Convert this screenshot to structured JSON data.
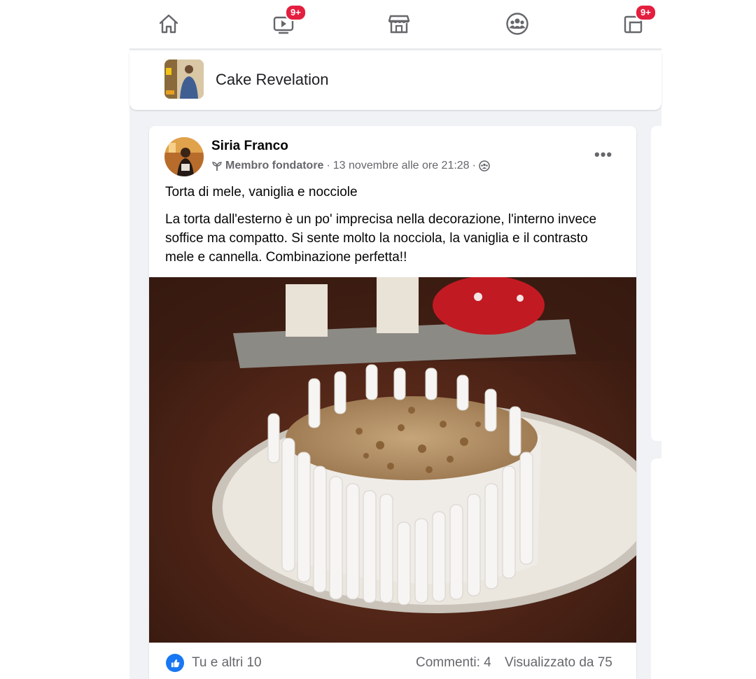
{
  "nav": {
    "items": [
      {
        "name": "home-icon",
        "badge": ""
      },
      {
        "name": "video-icon",
        "badge": "9+"
      },
      {
        "name": "marketplace-icon",
        "badge": ""
      },
      {
        "name": "groups-icon",
        "badge": ""
      },
      {
        "name": "gaming-icon",
        "badge": "9+"
      }
    ],
    "badge_color": "#e41e3f"
  },
  "group": {
    "name": "Cake Revelation"
  },
  "post": {
    "author": "Siria Franco",
    "role": "Membro fondatore",
    "separator": "·",
    "timestamp": "13 novembre alle ore 21:28",
    "privacy_icon": "group-audience-icon",
    "title": "Torta di mele, vaniglia e nocciole",
    "body": "La torta dall'esterno è un po' imprecisa nella decorazione, l'interno invece soffice ma compatto. Si sente molto la nocciola, la vaniglia e il contrasto mele e cannella. Combinazione perfetta!!",
    "more_label": "•••",
    "likes": "Tu e altri 10",
    "comments": "Commenti: 4",
    "views": "Visualizzato da 75",
    "like_color": "#1877f2"
  }
}
